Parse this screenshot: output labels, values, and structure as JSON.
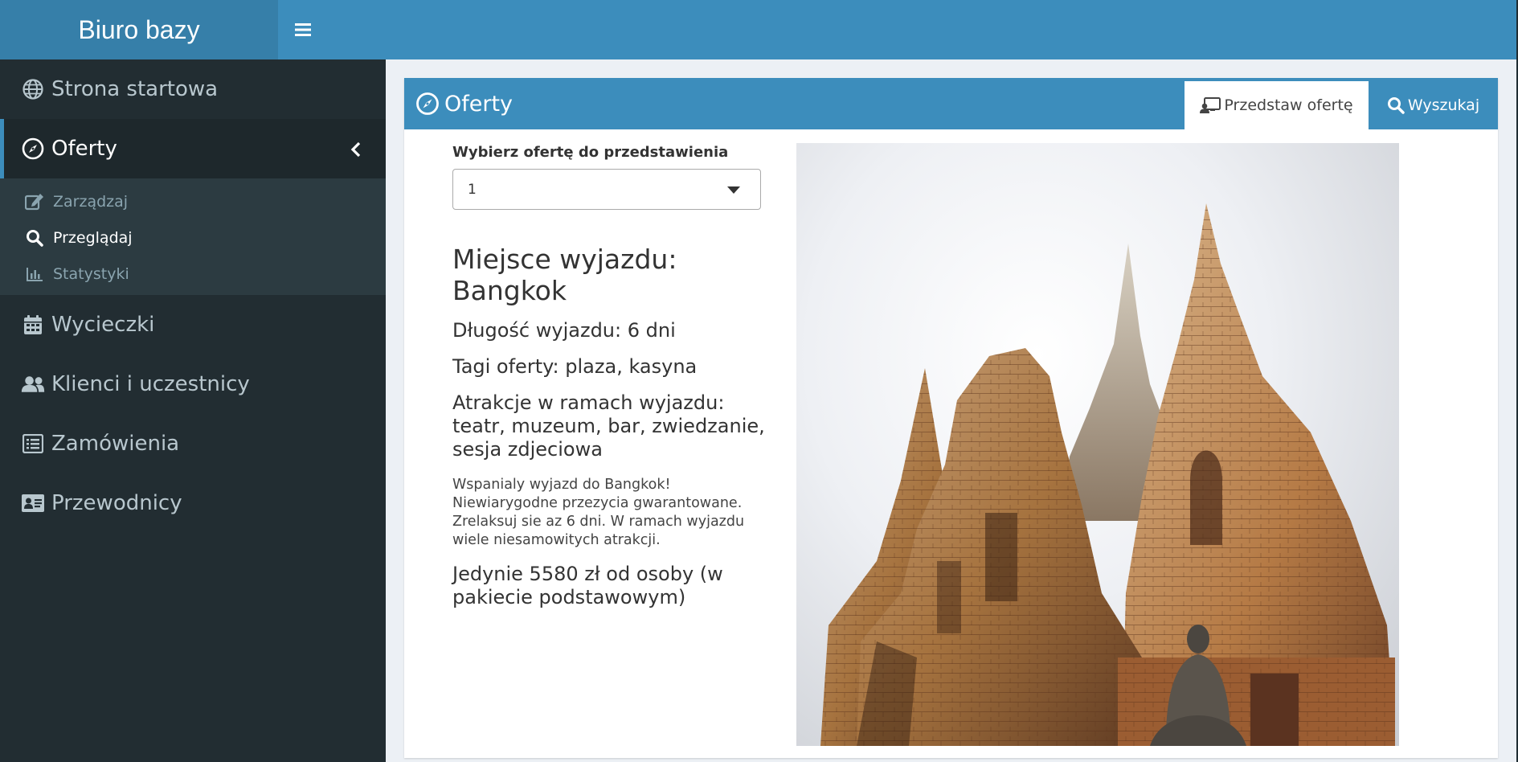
{
  "app": {
    "title": "Biuro bazy"
  },
  "sidebar": {
    "items": [
      {
        "label": "Strona startowa"
      },
      {
        "label": "Oferty"
      },
      {
        "label": "Wycieczki"
      },
      {
        "label": "Klienci i uczestnicy"
      },
      {
        "label": "Zamówienia"
      },
      {
        "label": "Przewodnicy"
      }
    ],
    "submenu": [
      {
        "label": "Zarządzaj"
      },
      {
        "label": "Przeglądaj"
      },
      {
        "label": "Statystyki"
      }
    ]
  },
  "box": {
    "title": "Oferty",
    "tabs": [
      {
        "label": "Przedstaw ofertę"
      },
      {
        "label": "Wyszukaj"
      }
    ]
  },
  "offer": {
    "select_label": "Wybierz ofertę do przedstawienia",
    "selected_value": "1",
    "destination_label": "Miejsce wyjazdu:",
    "destination": "Bangkok",
    "duration": "Długość wyjazdu: 6 dni",
    "tags": "Tagi oferty: plaza, kasyna",
    "attractions": "Atrakcje w ramach wyjazdu: teatr, muzeum, bar, zwiedzanie, sesja zdjeciowa",
    "description": "Wspanialy wyjazd do Bangkok! Niewiarygodne przezycia gwarantowane. Zrelaksuj sie az 6 dni. W ramach wyjazdu wiele niesamowitych atrakcji.",
    "price": "Jedynie 5580 zł od osoby (w pakiecie podstawowym)"
  },
  "colors": {
    "header": "#3c8dbc",
    "logo_bg": "#367fa9",
    "sidebar_bg": "#222d32",
    "sidebar_active": "#1e282c",
    "submenu_bg": "#2c3b41",
    "content_bg": "#ecf0f5"
  },
  "icons": {
    "menu": "bars-icon",
    "nav": [
      "globe-icon",
      "compass-icon",
      "calendar-icon",
      "users-icon",
      "list-icon",
      "id-card-icon"
    ],
    "submenu": [
      "edit-icon",
      "search-icon",
      "bar-chart-icon"
    ],
    "tabs": [
      "presentation-icon",
      "search-icon"
    ]
  }
}
